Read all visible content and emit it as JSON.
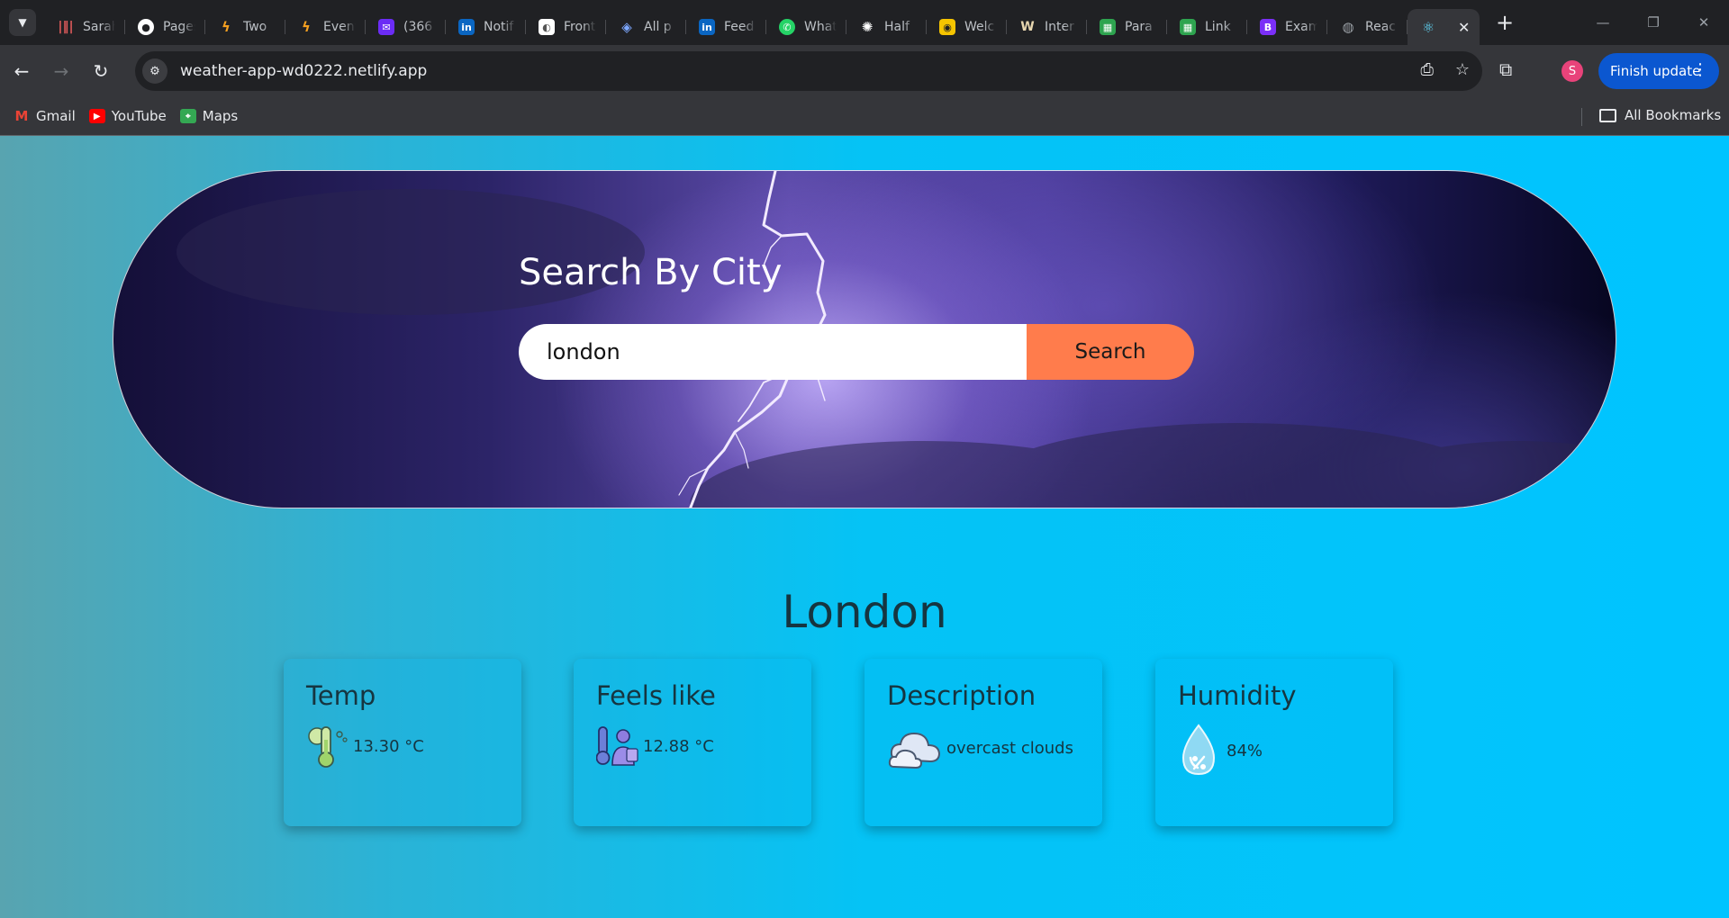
{
  "browser": {
    "tabs": [
      {
        "title": "Sarah",
        "icon": "audio-wave-icon",
        "color": "#e05b5b"
      },
      {
        "title": "Pages",
        "icon": "github-icon",
        "color": "#ffffff"
      },
      {
        "title": "Two",
        "icon": "lightning-icon",
        "color": "#f4a020"
      },
      {
        "title": "Event",
        "icon": "lightning-icon",
        "color": "#f4a020"
      },
      {
        "title": "(366",
        "icon": "mail-icon",
        "color": "#6b2cf5"
      },
      {
        "title": "Notif",
        "icon": "linkedin-icon",
        "color": "#0a66c2"
      },
      {
        "title": "Front",
        "icon": "front-icon",
        "color": "#ffffff"
      },
      {
        "title": "All p",
        "icon": "diamond-icon",
        "color": "#7da8ff"
      },
      {
        "title": "Feed",
        "icon": "linkedin-icon",
        "color": "#0a66c2"
      },
      {
        "title": "What",
        "icon": "whatsapp-icon",
        "color": "#25d366"
      },
      {
        "title": "Half",
        "icon": "openai-icon",
        "color": "#ffffff"
      },
      {
        "title": "Welc",
        "icon": "coin-icon",
        "color": "#f5c400"
      },
      {
        "title": "Inter",
        "icon": "w-icon",
        "color": "#e8d7b0"
      },
      {
        "title": "Para",
        "icon": "sheet-icon",
        "color": "#2ea44f"
      },
      {
        "title": "Link",
        "icon": "sheet-icon",
        "color": "#2ea44f"
      },
      {
        "title": "Exam",
        "icon": "bootstrap-icon",
        "color": "#7b2ff7"
      },
      {
        "title": "Reac",
        "icon": "globe-icon",
        "color": "#9aa0a6"
      }
    ],
    "active_tab_icon": "react-icon",
    "url": "weather-app-wd0222.netlify.app",
    "finish_update": "Finish update",
    "avatar_letter": "S",
    "bookmarks": [
      {
        "label": "Gmail",
        "icon": "gmail-icon"
      },
      {
        "label": "YouTube",
        "icon": "youtube-icon"
      },
      {
        "label": "Maps",
        "icon": "maps-icon"
      }
    ],
    "all_bookmarks": "All Bookmarks"
  },
  "page": {
    "hero_title": "Search By City",
    "search_value": "london",
    "search_button": "Search",
    "city": "London",
    "cards": [
      {
        "title": "Temp",
        "value": "13.30 °C",
        "icon": "thermometer-icon"
      },
      {
        "title": "Feels like",
        "value": "12.88 °C",
        "icon": "feels-like-icon"
      },
      {
        "title": "Description",
        "value": "overcast clouds",
        "icon": "cloud-icon"
      },
      {
        "title": "Humidity",
        "value": "84%",
        "icon": "humidity-drop-icon"
      }
    ],
    "colors": {
      "search_button": "#ff7c4c",
      "page_background": "#00c4ff",
      "text_dark": "#163540"
    }
  }
}
